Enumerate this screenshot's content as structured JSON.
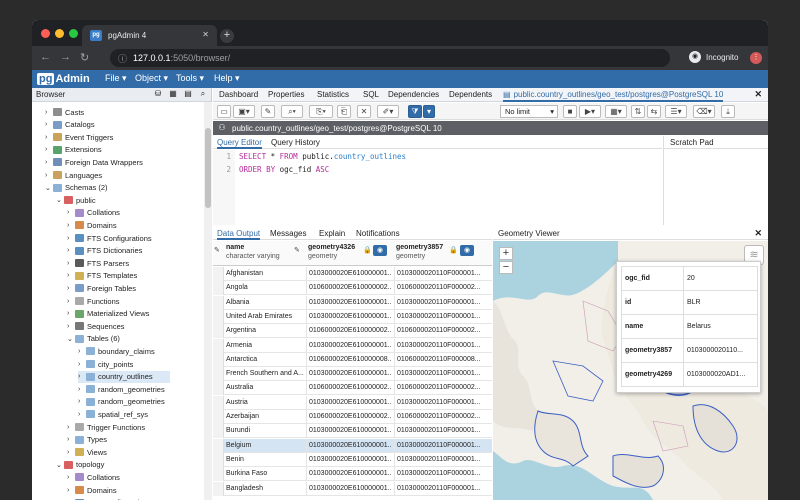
{
  "browser": {
    "tab_title": "pgAdmin 4",
    "favicon_text": "pg",
    "url_host": "127.0.0.1",
    "url_path": ":5050/browser/",
    "incognito_label": "Incognito"
  },
  "app": {
    "logo_pg": "pg",
    "logo_rest": "Admin",
    "menus": [
      "File ▾",
      "Object ▾",
      "Tools ▾",
      "Help ▾"
    ]
  },
  "browser_panel": {
    "title": "Browser"
  },
  "tree": [
    {
      "label": "Casts",
      "indent": 3,
      "toggle": "›",
      "color": "#8e8e8e"
    },
    {
      "label": "Catalogs",
      "indent": 3,
      "toggle": "›",
      "color": "#7a9cc6"
    },
    {
      "label": "Event Triggers",
      "indent": 3,
      "toggle": "›",
      "color": "#caa35a"
    },
    {
      "label": "Extensions",
      "indent": 3,
      "toggle": "›",
      "color": "#58a36b"
    },
    {
      "label": "Foreign Data Wrappers",
      "indent": 3,
      "toggle": "›",
      "color": "#6f8fb8"
    },
    {
      "label": "Languages",
      "indent": 3,
      "toggle": "›",
      "color": "#c9a25d"
    },
    {
      "label": "Schemas (2)",
      "indent": 3,
      "toggle": "⌄",
      "color": "#8bb1d6"
    },
    {
      "label": "public",
      "indent": 4,
      "toggle": "⌄",
      "color": "#d96060"
    },
    {
      "label": "Collations",
      "indent": 5,
      "toggle": "›",
      "color": "#a58bcd"
    },
    {
      "label": "Domains",
      "indent": 5,
      "toggle": "›",
      "color": "#d68a4c"
    },
    {
      "label": "FTS Configurations",
      "indent": 5,
      "toggle": "›",
      "color": "#5a8fc2"
    },
    {
      "label": "FTS Dictionaries",
      "indent": 5,
      "toggle": "›",
      "color": "#5a8fc2"
    },
    {
      "label": "FTS Parsers",
      "indent": 5,
      "toggle": "›",
      "color": "#5a5a5a"
    },
    {
      "label": "FTS Templates",
      "indent": 5,
      "toggle": "›",
      "color": "#d0b055"
    },
    {
      "label": "Foreign Tables",
      "indent": 5,
      "toggle": "›",
      "color": "#7a9cc6"
    },
    {
      "label": "Functions",
      "indent": 5,
      "toggle": "›",
      "color": "#a9a9a9"
    },
    {
      "label": "Materialized Views",
      "indent": 5,
      "toggle": "›",
      "color": "#6aa56a"
    },
    {
      "label": "Sequences",
      "indent": 5,
      "toggle": "›",
      "color": "#777777"
    },
    {
      "label": "Tables (6)",
      "indent": 5,
      "toggle": "⌄",
      "color": "#8bb1d6"
    },
    {
      "label": "boundary_claims",
      "indent": 6,
      "toggle": "›",
      "color": "#8bb1d6"
    },
    {
      "label": "city_points",
      "indent": 6,
      "toggle": "›",
      "color": "#8bb1d6"
    },
    {
      "label": "country_outlines",
      "indent": 6,
      "toggle": "›",
      "color": "#8bb1d6",
      "selected": true
    },
    {
      "label": "random_geometries",
      "indent": 6,
      "toggle": "›",
      "color": "#8bb1d6"
    },
    {
      "label": "random_geometries",
      "indent": 6,
      "toggle": "›",
      "color": "#8bb1d6"
    },
    {
      "label": "spatial_ref_sys",
      "indent": 6,
      "toggle": "›",
      "color": "#8bb1d6"
    },
    {
      "label": "Trigger Functions",
      "indent": 5,
      "toggle": "›",
      "color": "#a9a9a9"
    },
    {
      "label": "Types",
      "indent": 5,
      "toggle": "›",
      "color": "#8bb1d6"
    },
    {
      "label": "Views",
      "indent": 5,
      "toggle": "›",
      "color": "#d0b055"
    },
    {
      "label": "topology",
      "indent": 4,
      "toggle": "⌄",
      "color": "#d96060"
    },
    {
      "label": "Collations",
      "indent": 5,
      "toggle": "›",
      "color": "#a58bcd"
    },
    {
      "label": "Domains",
      "indent": 5,
      "toggle": "›",
      "color": "#d68a4c"
    },
    {
      "label": "FTS Configurations",
      "indent": 5,
      "toggle": "›",
      "color": "#5a8fc2"
    }
  ],
  "top_tabs": {
    "items": [
      "Dashboard",
      "Properties",
      "Statistics",
      "SQL",
      "Dependencies",
      "Dependents"
    ],
    "active_tab": "public.country_outlines/geo_test/postgres@PostgreSQL 10"
  },
  "toolbar": {
    "limit_label": "No limit"
  },
  "connection": {
    "label": "public.country_outlines/geo_test/postgres@PostgreSQL 10"
  },
  "editor": {
    "tabs": [
      "Query Editor",
      "Query History"
    ],
    "scratch_pad": "Scratch Pad",
    "lines": [
      {
        "num": "1",
        "kw1": "SELECT",
        "mid": " * ",
        "kw2": "FROM",
        "schema": " public.",
        "table": "country_outlines"
      },
      {
        "num": "2",
        "kw1": "ORDER BY",
        "mid": " ogc_fid ",
        "kw2": "ASC",
        "schema": "",
        "table": ""
      }
    ]
  },
  "output": {
    "tabs": [
      "Data Output",
      "Messages",
      "Explain",
      "Notifications"
    ],
    "columns": [
      {
        "name": "name",
        "type": "character varying"
      },
      {
        "name": "geometry4326",
        "type": "geometry"
      },
      {
        "name": "geometry3857",
        "type": "geometry"
      }
    ],
    "rows": [
      {
        "name": "Afghanistan",
        "g4326": "0103000020E610000001...",
        "g3857": "0103000020110F000001..."
      },
      {
        "name": "Angola",
        "g4326": "0106000020E610000002...",
        "g3857": "0106000020110F000002..."
      },
      {
        "name": "Albania",
        "g4326": "0103000020E610000001...",
        "g3857": "0103000020110F000001..."
      },
      {
        "name": "United Arab Emirates",
        "g4326": "0103000020E610000001...",
        "g3857": "0103000020110F000001..."
      },
      {
        "name": "Argentina",
        "g4326": "0106000020E610000002...",
        "g3857": "0106000020110F000002..."
      },
      {
        "name": "Armenia",
        "g4326": "0103000020E610000001...",
        "g3857": "0103000020110F000001..."
      },
      {
        "name": "Antarctica",
        "g4326": "0106000020E610000008...",
        "g3857": "0106000020110F000008..."
      },
      {
        "name": "French Southern and A...",
        "g4326": "0103000020E610000001...",
        "g3857": "0103000020110F000001..."
      },
      {
        "name": "Australia",
        "g4326": "0106000020E610000002...",
        "g3857": "0106000020110F000002..."
      },
      {
        "name": "Austria",
        "g4326": "0103000020E610000001...",
        "g3857": "0103000020110F000001..."
      },
      {
        "name": "Azerbaijan",
        "g4326": "0106000020E610000002...",
        "g3857": "0106000020110F000002..."
      },
      {
        "name": "Burundi",
        "g4326": "0103000020E610000001...",
        "g3857": "0103000020110F000001..."
      },
      {
        "name": "Belgium",
        "g4326": "0103000020E610000001...",
        "g3857": "0103000020110F000001...",
        "selected": true
      },
      {
        "name": "Benin",
        "g4326": "0103000020E610000001...",
        "g3857": "0103000020110F000001..."
      },
      {
        "name": "Burkina Faso",
        "g4326": "0103000020E610000001...",
        "g3857": "0103000020110F000001..."
      },
      {
        "name": "Bangladesh",
        "g4326": "0103000020E610000001...",
        "g3857": "0103000020110F000001..."
      }
    ]
  },
  "geometry_viewer": {
    "title": "Geometry Viewer",
    "popup": [
      {
        "key": "ogc_fid",
        "value": "20"
      },
      {
        "key": "id",
        "value": "BLR"
      },
      {
        "key": "name",
        "value": "Belarus"
      },
      {
        "key": "geometry3857",
        "value": "0103000020110..."
      },
      {
        "key": "geometry4269",
        "value": "0103000020AD1..."
      }
    ]
  }
}
